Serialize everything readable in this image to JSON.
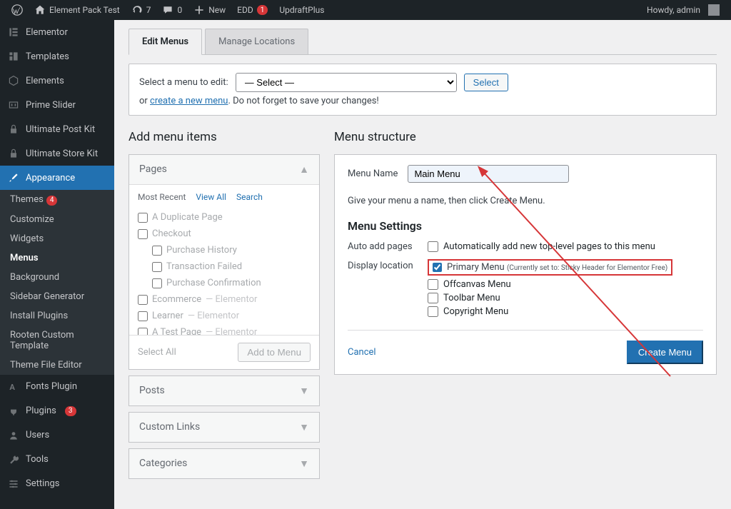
{
  "adminbar": {
    "site_title": "Element Pack Test",
    "updates": "7",
    "comments": "0",
    "new": "New",
    "edd_label": "EDD",
    "edd_count": "1",
    "updraft": "UpdraftPlus",
    "howdy": "Howdy, admin"
  },
  "sidebar": {
    "elementor": "Elementor",
    "templates": "Templates",
    "elements": "Elements",
    "prime_slider": "Prime Slider",
    "ultimate_post": "Ultimate Post Kit",
    "ultimate_store": "Ultimate Store Kit",
    "appearance": "Appearance",
    "sub": {
      "themes": "Themes",
      "themes_count": "4",
      "customize": "Customize",
      "widgets": "Widgets",
      "menus": "Menus",
      "background": "Background",
      "sidebar_gen": "Sidebar Generator",
      "install_plugins": "Install Plugins",
      "rooten": "Rooten Custom Template",
      "theme_editor": "Theme File Editor"
    },
    "fonts_plugin": "Fonts Plugin",
    "plugins": "Plugins",
    "plugins_count": "3",
    "users": "Users",
    "tools": "Tools",
    "settings": "Settings"
  },
  "tabs": {
    "edit": "Edit Menus",
    "manage": "Manage Locations"
  },
  "selectbox": {
    "label": "Select a menu to edit:",
    "option": "— Select —",
    "select_btn": "Select",
    "or": "or ",
    "create_link": "create a new menu",
    "hint": ". Do not forget to save your changes!"
  },
  "left": {
    "title": "Add menu items",
    "pages": "Pages",
    "most_recent": "Most Recent",
    "view_all": "View All",
    "search": "Search",
    "items": [
      {
        "label": "A Duplicate Page",
        "indent": false
      },
      {
        "label": "Checkout",
        "indent": false
      },
      {
        "label": "Purchase History",
        "indent": true
      },
      {
        "label": "Transaction Failed",
        "indent": true
      },
      {
        "label": "Purchase Confirmation",
        "indent": true
      },
      {
        "label": "Ecommerce",
        "suffix": " — Elementor",
        "indent": false
      },
      {
        "label": "Learner",
        "suffix": " — Elementor",
        "indent": false
      },
      {
        "label": "A Test Page",
        "suffix": " — Elementor",
        "indent": false
      }
    ],
    "select_all": "Select All",
    "add_to_menu": "Add to Menu",
    "posts": "Posts",
    "custom_links": "Custom Links",
    "categories": "Categories"
  },
  "right": {
    "title": "Menu structure",
    "menu_name_label": "Menu Name",
    "menu_name_value": "Main Menu",
    "hint": "Give your menu a name, then click Create Menu.",
    "settings_title": "Menu Settings",
    "auto_add_label": "Auto add pages",
    "auto_add_text": "Automatically add new top-level pages to this menu",
    "display_label": "Display location",
    "primary_menu": "Primary Menu",
    "primary_suffix": "(Currently set to: Sticky Header for Elementor Free)",
    "offcanvas": "Offcanvas Menu",
    "toolbar": "Toolbar Menu",
    "copyright": "Copyright Menu",
    "cancel": "Cancel",
    "create": "Create Menu"
  }
}
